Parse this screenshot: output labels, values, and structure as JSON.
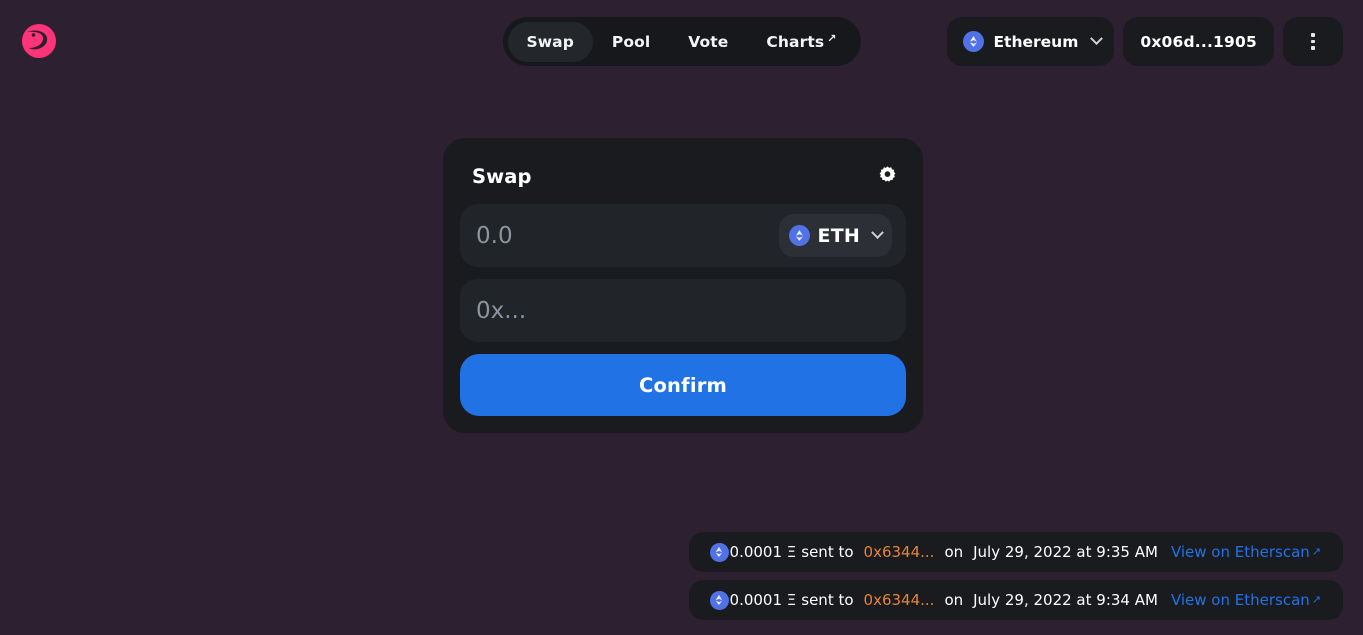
{
  "theme": {
    "background": "#2d2030",
    "surface": "#191b1f",
    "field": "#212429",
    "accent_blue": "#2172e5",
    "accent_orange": "#e8833a",
    "logo_pink": "#ff3377"
  },
  "header": {
    "logo_name": "uniswap-logo",
    "nav": [
      {
        "label": "Swap",
        "active": true,
        "external": false
      },
      {
        "label": "Pool",
        "active": false,
        "external": false
      },
      {
        "label": "Vote",
        "active": false,
        "external": false
      },
      {
        "label": "Charts",
        "active": false,
        "external": true
      }
    ],
    "network": {
      "label": "Ethereum",
      "icon": "ethereum-icon",
      "chevron": "chevron-down-icon"
    },
    "account": {
      "address": "0x06d...1905"
    },
    "menu": {
      "icon": "more-vertical-icon"
    },
    "external_arrow": "↗"
  },
  "swap_card": {
    "title": "Swap",
    "settings_icon": "gear-icon",
    "amount_field": {
      "value": "",
      "placeholder": "0.0"
    },
    "token": {
      "symbol": "ETH",
      "icon": "ethereum-icon",
      "chevron": "chevron-down-icon"
    },
    "address_field": {
      "value": "",
      "placeholder": "0x..."
    },
    "confirm_label": "Confirm"
  },
  "toasts": [
    {
      "icon": "ethereum-icon",
      "amount": "0.0001 Ξ",
      "action": "sent to",
      "address": "0x6344...",
      "preposition": "on",
      "timestamp": "July 29, 2022 at 9:35 AM",
      "link_label": "View on Etherscan",
      "link_arrow": "↗"
    },
    {
      "icon": "ethereum-icon",
      "amount": "0.0001 Ξ",
      "action": "sent to",
      "address": "0x6344...",
      "preposition": "on",
      "timestamp": "July 29, 2022 at 9:34 AM",
      "link_label": "View on Etherscan",
      "link_arrow": "↗"
    }
  ]
}
